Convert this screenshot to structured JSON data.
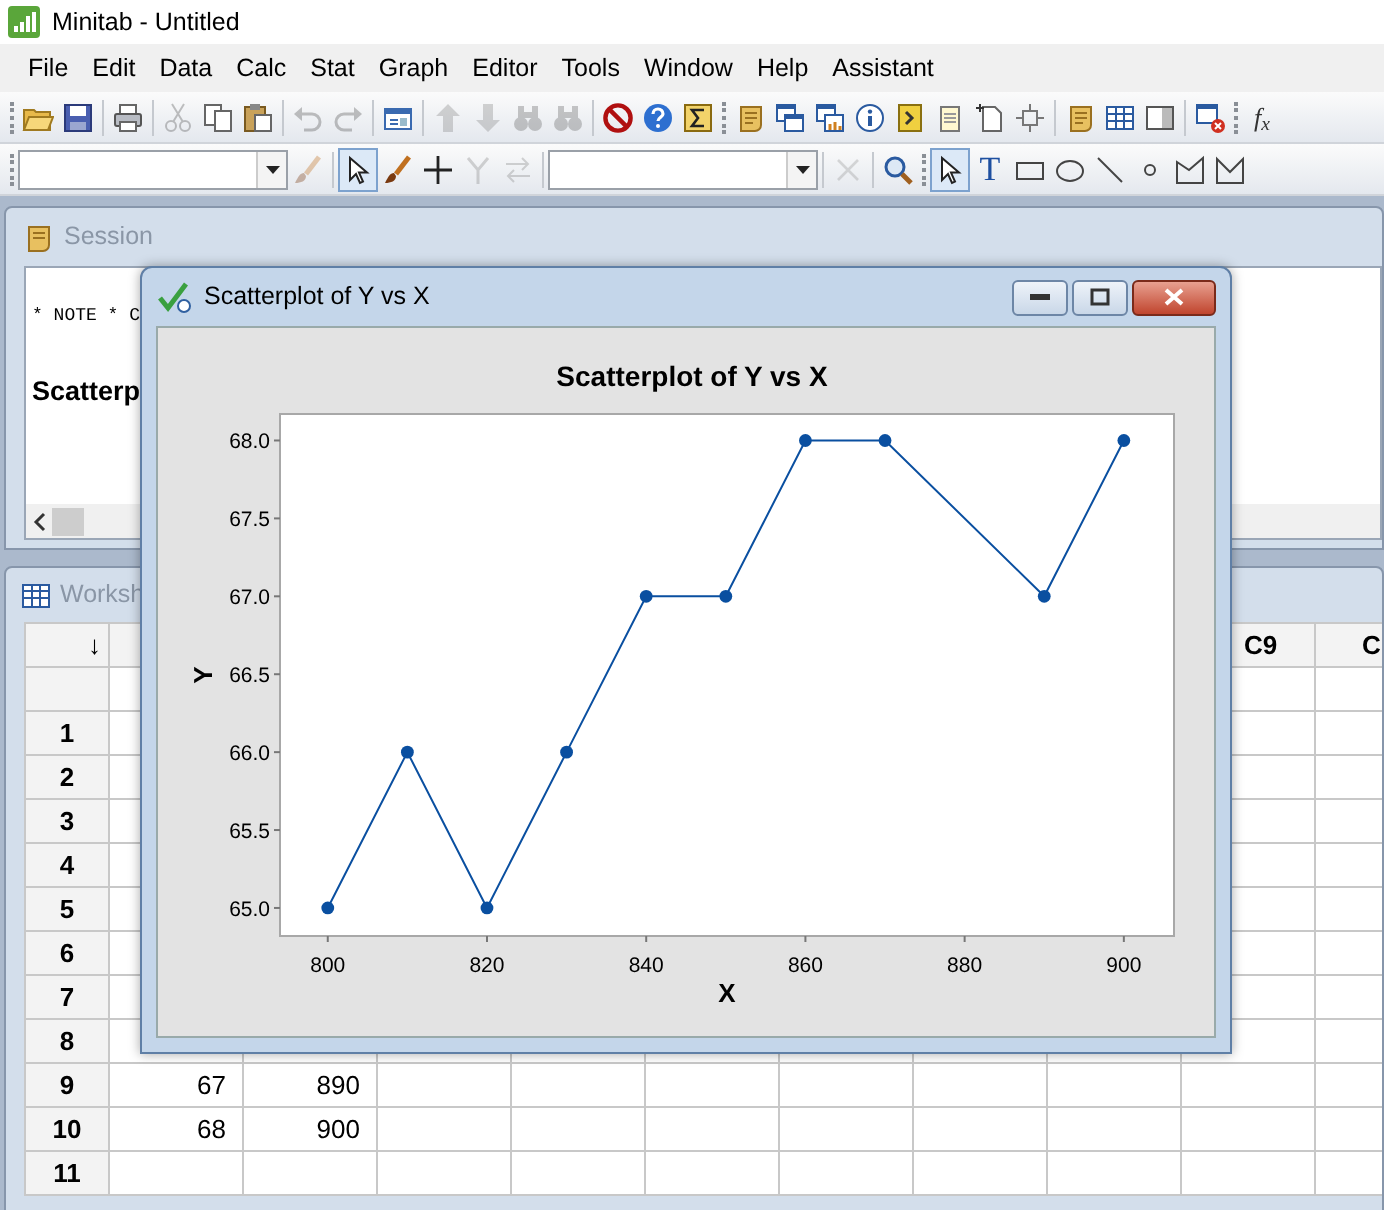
{
  "window": {
    "title": "Minitab - Untitled"
  },
  "menu": [
    {
      "label": "File"
    },
    {
      "label": "Edit"
    },
    {
      "label": "Data"
    },
    {
      "label": "Calc"
    },
    {
      "label": "Stat"
    },
    {
      "label": "Graph"
    },
    {
      "label": "Editor"
    },
    {
      "label": "Tools"
    },
    {
      "label": "Window"
    },
    {
      "label": "Help"
    },
    {
      "label": "Assistant"
    }
  ],
  "toolbars": [
    {
      "items": [
        {
          "kind": "grip"
        },
        {
          "kind": "open",
          "disabled": false
        },
        {
          "kind": "save",
          "disabled": false
        },
        {
          "kind": "separator"
        },
        {
          "kind": "print",
          "disabled": false
        },
        {
          "kind": "separator"
        },
        {
          "kind": "cut",
          "disabled": true
        },
        {
          "kind": "copy",
          "disabled": false
        },
        {
          "kind": "paste",
          "disabled": false
        },
        {
          "kind": "separator"
        },
        {
          "kind": "undo",
          "disabled": true
        },
        {
          "kind": "redo",
          "disabled": true
        },
        {
          "kind": "separator"
        },
        {
          "kind": "window",
          "disabled": false
        },
        {
          "kind": "separator"
        },
        {
          "kind": "up",
          "disabled": true
        },
        {
          "kind": "down",
          "disabled": true
        },
        {
          "kind": "find",
          "disabled": true
        },
        {
          "kind": "find",
          "disabled": true
        },
        {
          "kind": "separator"
        },
        {
          "kind": "stop",
          "disabled": false
        },
        {
          "kind": "help",
          "disabled": false
        },
        {
          "kind": "sigma",
          "disabled": false
        },
        {
          "kind": "grip"
        },
        {
          "kind": "scroll",
          "disabled": false
        },
        {
          "kind": "windows",
          "disabled": false
        },
        {
          "kind": "windows-chart",
          "disabled": false
        },
        {
          "kind": "info",
          "disabled": false
        },
        {
          "kind": "prompt",
          "disabled": false
        },
        {
          "kind": "notes",
          "disabled": false
        },
        {
          "kind": "new-page",
          "disabled": false
        },
        {
          "kind": "crop",
          "disabled": false
        },
        {
          "kind": "separator"
        },
        {
          "kind": "scroll",
          "disabled": false
        },
        {
          "kind": "table",
          "disabled": false
        },
        {
          "kind": "panel",
          "disabled": false
        },
        {
          "kind": "separator"
        },
        {
          "kind": "close-windows",
          "disabled": false
        },
        {
          "kind": "grip"
        },
        {
          "kind": "fx",
          "label": "f$_{x}$",
          "disabled": false
        }
      ]
    },
    {
      "items": [
        {
          "kind": "grip"
        },
        {
          "kind": "combo"
        },
        {
          "kind": "brush",
          "disabled": true,
          "selected": false
        },
        {
          "kind": "separator"
        },
        {
          "kind": "pointer",
          "disabled": false,
          "selected": true
        },
        {
          "kind": "brush",
          "disabled": false,
          "selected": false
        },
        {
          "kind": "plus",
          "disabled": false,
          "selected": false
        },
        {
          "kind": "fork",
          "disabled": true,
          "selected": false
        },
        {
          "kind": "swap",
          "disabled": true,
          "selected": false
        },
        {
          "kind": "separator"
        },
        {
          "kind": "combo"
        },
        {
          "kind": "separator"
        },
        {
          "kind": "close",
          "disabled": true,
          "selected": false
        },
        {
          "kind": "separator"
        },
        {
          "kind": "search",
          "disabled": false,
          "selected": false
        },
        {
          "kind": "grip"
        },
        {
          "kind": "pointer",
          "disabled": false,
          "selected": true
        },
        {
          "kind": "text-tool",
          "label": "T",
          "disabled": false,
          "selected": false
        },
        {
          "kind": "rect",
          "disabled": false,
          "selected": false
        },
        {
          "kind": "ellipse",
          "disabled": false,
          "selected": false
        },
        {
          "kind": "line",
          "disabled": false,
          "selected": false
        },
        {
          "kind": "dot",
          "disabled": false,
          "selected": false
        },
        {
          "kind": "polygon",
          "disabled": false,
          "selected": false
        },
        {
          "kind": "notch",
          "disabled": false,
          "selected": false
        }
      ]
    }
  ],
  "session": {
    "title": "Session",
    "active": false,
    "lines": [
      {
        "kind": "note",
        "text": "* NOTE * C"
      },
      {
        "kind": "heading",
        "text": "Scatterp"
      }
    ]
  },
  "worksheet": {
    "title": "Worksh",
    "active": false,
    "corner": "↓",
    "columns": [
      {
        "label": "C9"
      },
      {
        "label": "C"
      }
    ],
    "rows": [
      {
        "label": "1"
      },
      {
        "label": "2"
      },
      {
        "label": "3"
      },
      {
        "label": "4"
      },
      {
        "label": "5"
      },
      {
        "label": "6"
      },
      {
        "label": "7"
      },
      {
        "label": "8"
      },
      {
        "label": "9",
        "cells": [
          "67",
          "890"
        ]
      },
      {
        "label": "10",
        "cells": [
          "68",
          "900"
        ]
      },
      {
        "label": "11"
      }
    ]
  },
  "graph_window": {
    "title": "Scatterplot of Y vs X",
    "active": true,
    "chart_data": {
      "type": "line",
      "title": "Scatterplot of Y vs X",
      "xlabel": "X",
      "ylabel": "Y",
      "x": [
        800,
        810,
        820,
        830,
        840,
        850,
        860,
        870,
        890,
        900
      ],
      "series": [
        {
          "color": "#0a4fa0",
          "marker": "circle",
          "values": [
            65,
            66,
            65,
            66,
            67,
            67,
            68,
            68,
            67,
            68
          ]
        }
      ],
      "xlim": [
        794,
        906.3
      ],
      "ylim": [
        64.82,
        68.17
      ],
      "xticks": [
        800,
        820,
        840,
        860,
        880,
        900
      ],
      "yticks": [
        {
          "value": 65,
          "label": "65.0"
        },
        {
          "value": 65.5,
          "label": "65.5"
        },
        {
          "value": 66,
          "label": "66.0"
        },
        {
          "value": 66.5,
          "label": "66.5"
        },
        {
          "value": 67,
          "label": "67.0"
        },
        {
          "value": 67.5,
          "label": "67.5"
        },
        {
          "value": 68,
          "label": "68.0"
        }
      ]
    }
  }
}
